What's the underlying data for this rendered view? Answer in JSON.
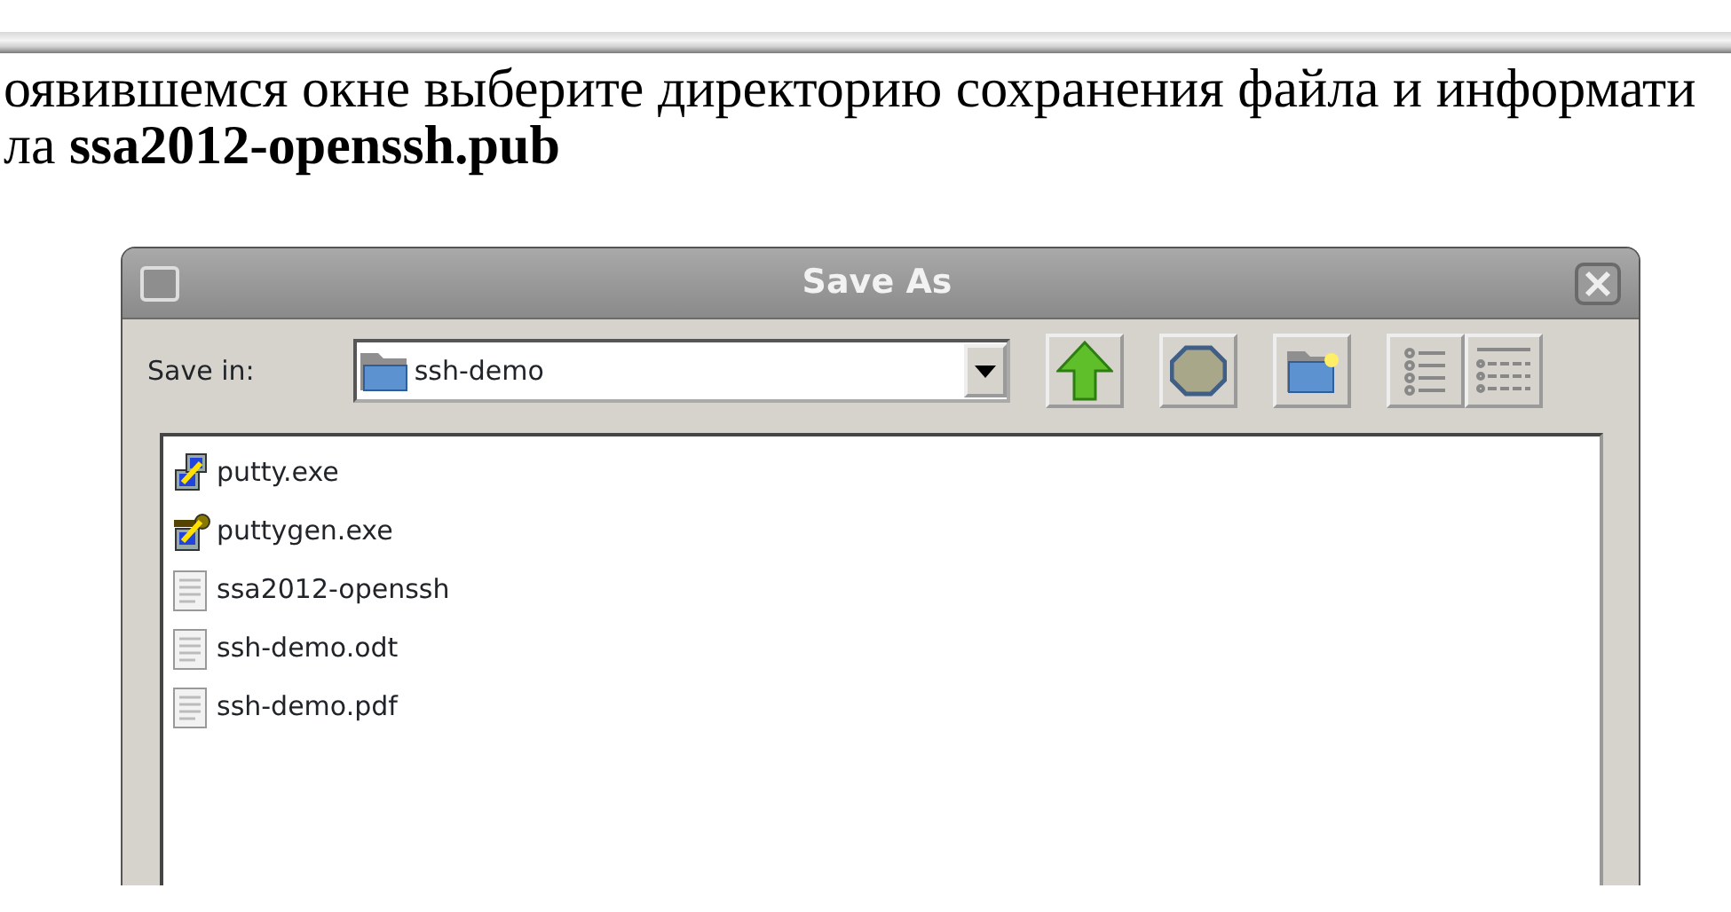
{
  "instructions": [
    "оявившемся окне выберите директорию сохранения файла и информати",
    "ла **ssa2012-openssh.pub**"
  ],
  "dialog": {
    "title": "Save As",
    "save_in_label": "Save in:",
    "folder": "ssh-demo",
    "files": [
      {
        "name": "putty.exe",
        "kind": "putty"
      },
      {
        "name": "puttygen.exe",
        "kind": "puttygen"
      },
      {
        "name": "ssa2012-openssh",
        "kind": "document"
      },
      {
        "name": "ssh-demo.odt",
        "kind": "document"
      },
      {
        "name": "ssh-demo.pdf",
        "kind": "document"
      }
    ]
  }
}
